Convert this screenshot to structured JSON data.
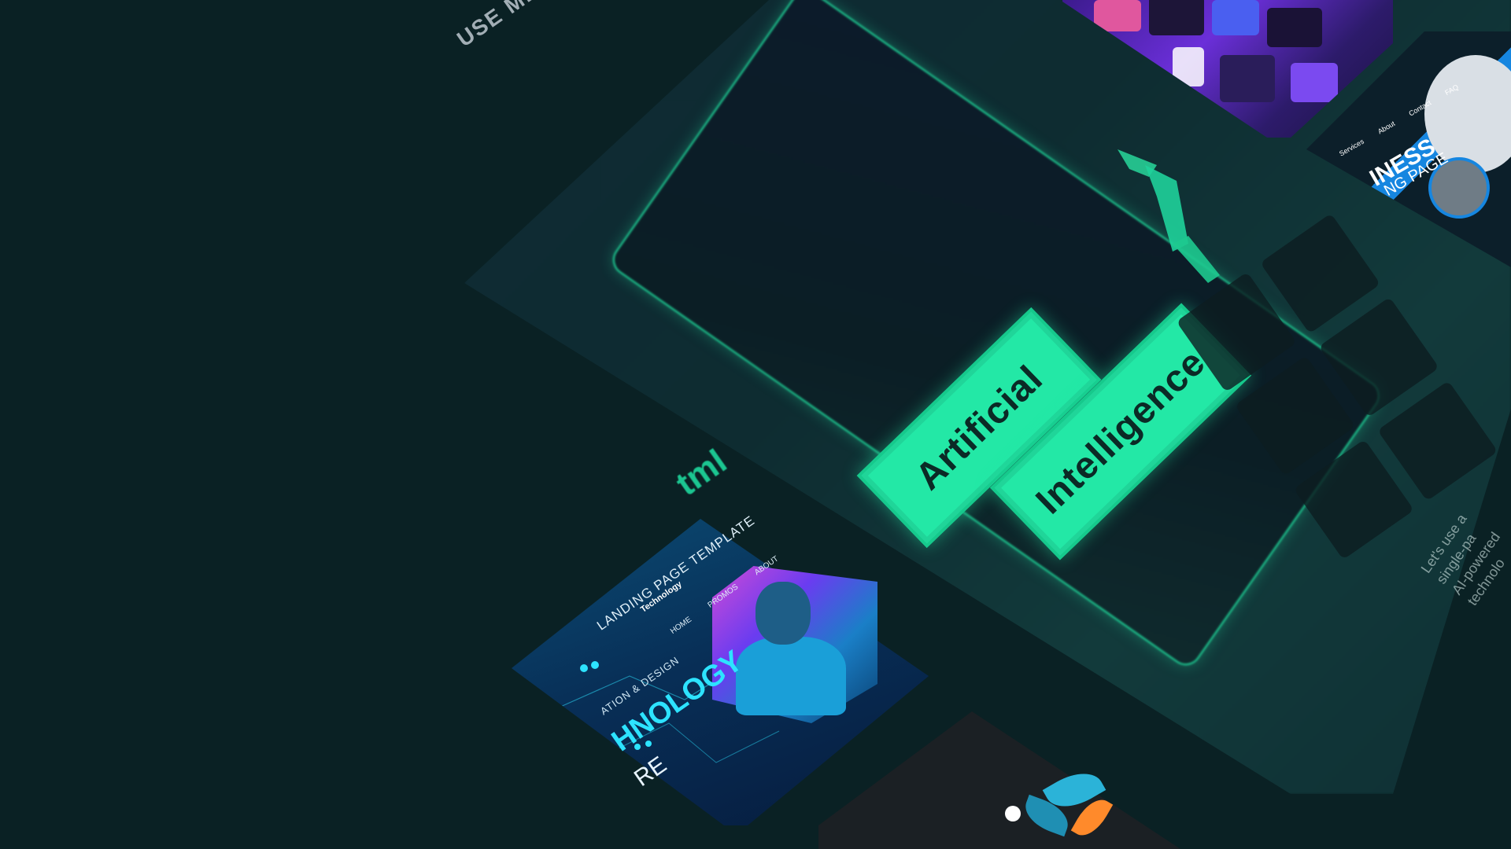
{
  "hero": {
    "top_title": "USE MEG",
    "html_fragment": "tml",
    "badge_1": "Artificial",
    "badge_2": "Intelligence",
    "side_line_1": "Let's use a single-pa",
    "side_line_2": "AI-powered technolo"
  },
  "business": {
    "title": "INESS",
    "subtitle": "NG PAGE",
    "nav": [
      "Services",
      "About",
      "Contact",
      "FAQ"
    ]
  },
  "technology": {
    "title": "LANDING PAGE TEMPLATE",
    "subtitle": "Technology",
    "nav": [
      "HOME",
      "PROMOS",
      "ABOUT"
    ],
    "small_line": "ATION & DESIGN",
    "big_line_1": "HNOLOGY",
    "big_line_2": "RE"
  },
  "colors": {
    "background": "#0a2124",
    "accent_green": "#23e8a6",
    "tech_blue": "#0b4c74",
    "business_blue": "#1686e0",
    "purple": "#6b2fd9"
  }
}
